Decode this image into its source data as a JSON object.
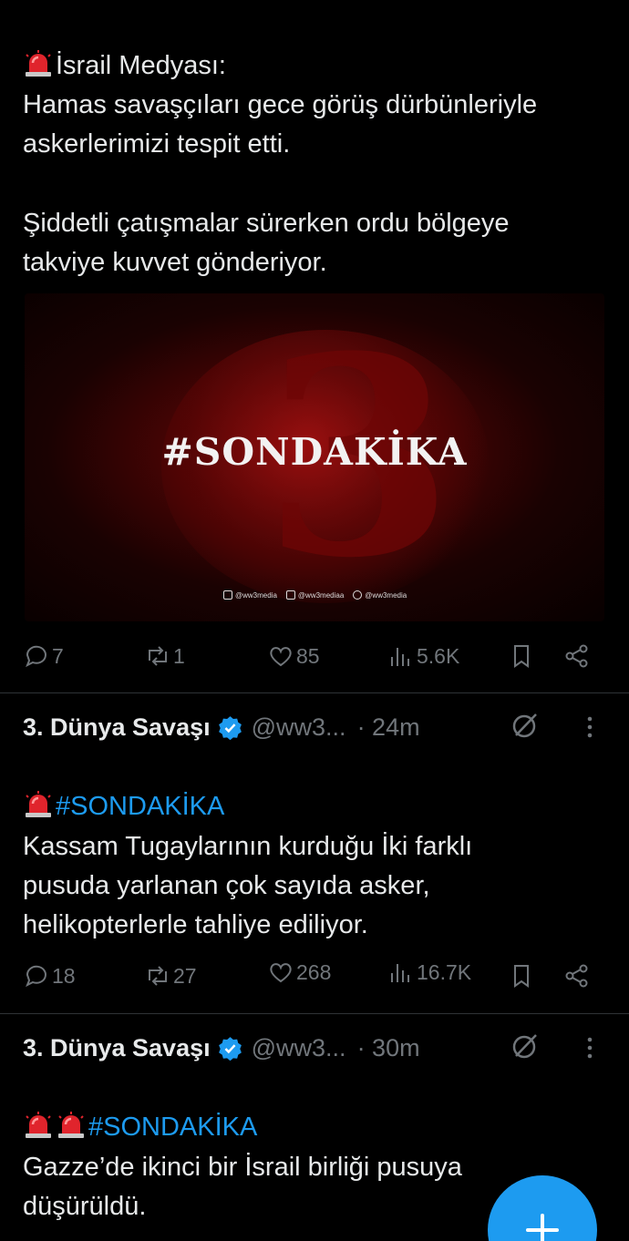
{
  "tweet1": {
    "title": "İsrail Medyası:",
    "para1": "Hamas savaşçıları gece görüş dürbünleriyle\naskerlerimizi tespit etti.",
    "para2": "Şiddetli çatışmalar sürerken ordu bölgeye\ntakviye kuvvet gönderiyor.",
    "media": {
      "headline": "#SONDAKİKA",
      "big_number": "3",
      "socials": [
        "@ww3media",
        "@ww3mediaa",
        "@ww3media"
      ]
    },
    "actions": {
      "replies": "7",
      "reposts": "1",
      "likes": "85",
      "views": "5.6K"
    }
  },
  "tweet2": {
    "author": "3. Dünya Savaşı",
    "handle": "@ww3...",
    "time": "· 24m",
    "hashtag": "#SONDAKİKA",
    "text": "Kassam Tugaylarının kurduğu İki farklı\npusuda yarlanan çok sayıda asker,\nhelikopterlerle tahliye ediliyor.",
    "actions": {
      "replies": "18",
      "reposts": "27",
      "likes": "268",
      "views": "16.7K"
    }
  },
  "tweet3": {
    "author": "3. Dünya Savaşı",
    "handle": "@ww3...",
    "time": "· 30m",
    "hashtag": "#SONDAKİKA",
    "text": "Gazze’de ikinci bir İsrail birliği pusuya\ndüşürüldü."
  },
  "colors": {
    "accent": "#1d9bf0",
    "muted": "#71767b",
    "text": "#e7e9ea",
    "background": "#000000"
  },
  "icons": [
    "siren-icon",
    "reply-icon",
    "repost-icon",
    "like-icon",
    "views-icon",
    "bookmark-icon",
    "share-icon",
    "verified-badge-icon",
    "grok-icon",
    "more-icon",
    "compose-plus-icon"
  ]
}
